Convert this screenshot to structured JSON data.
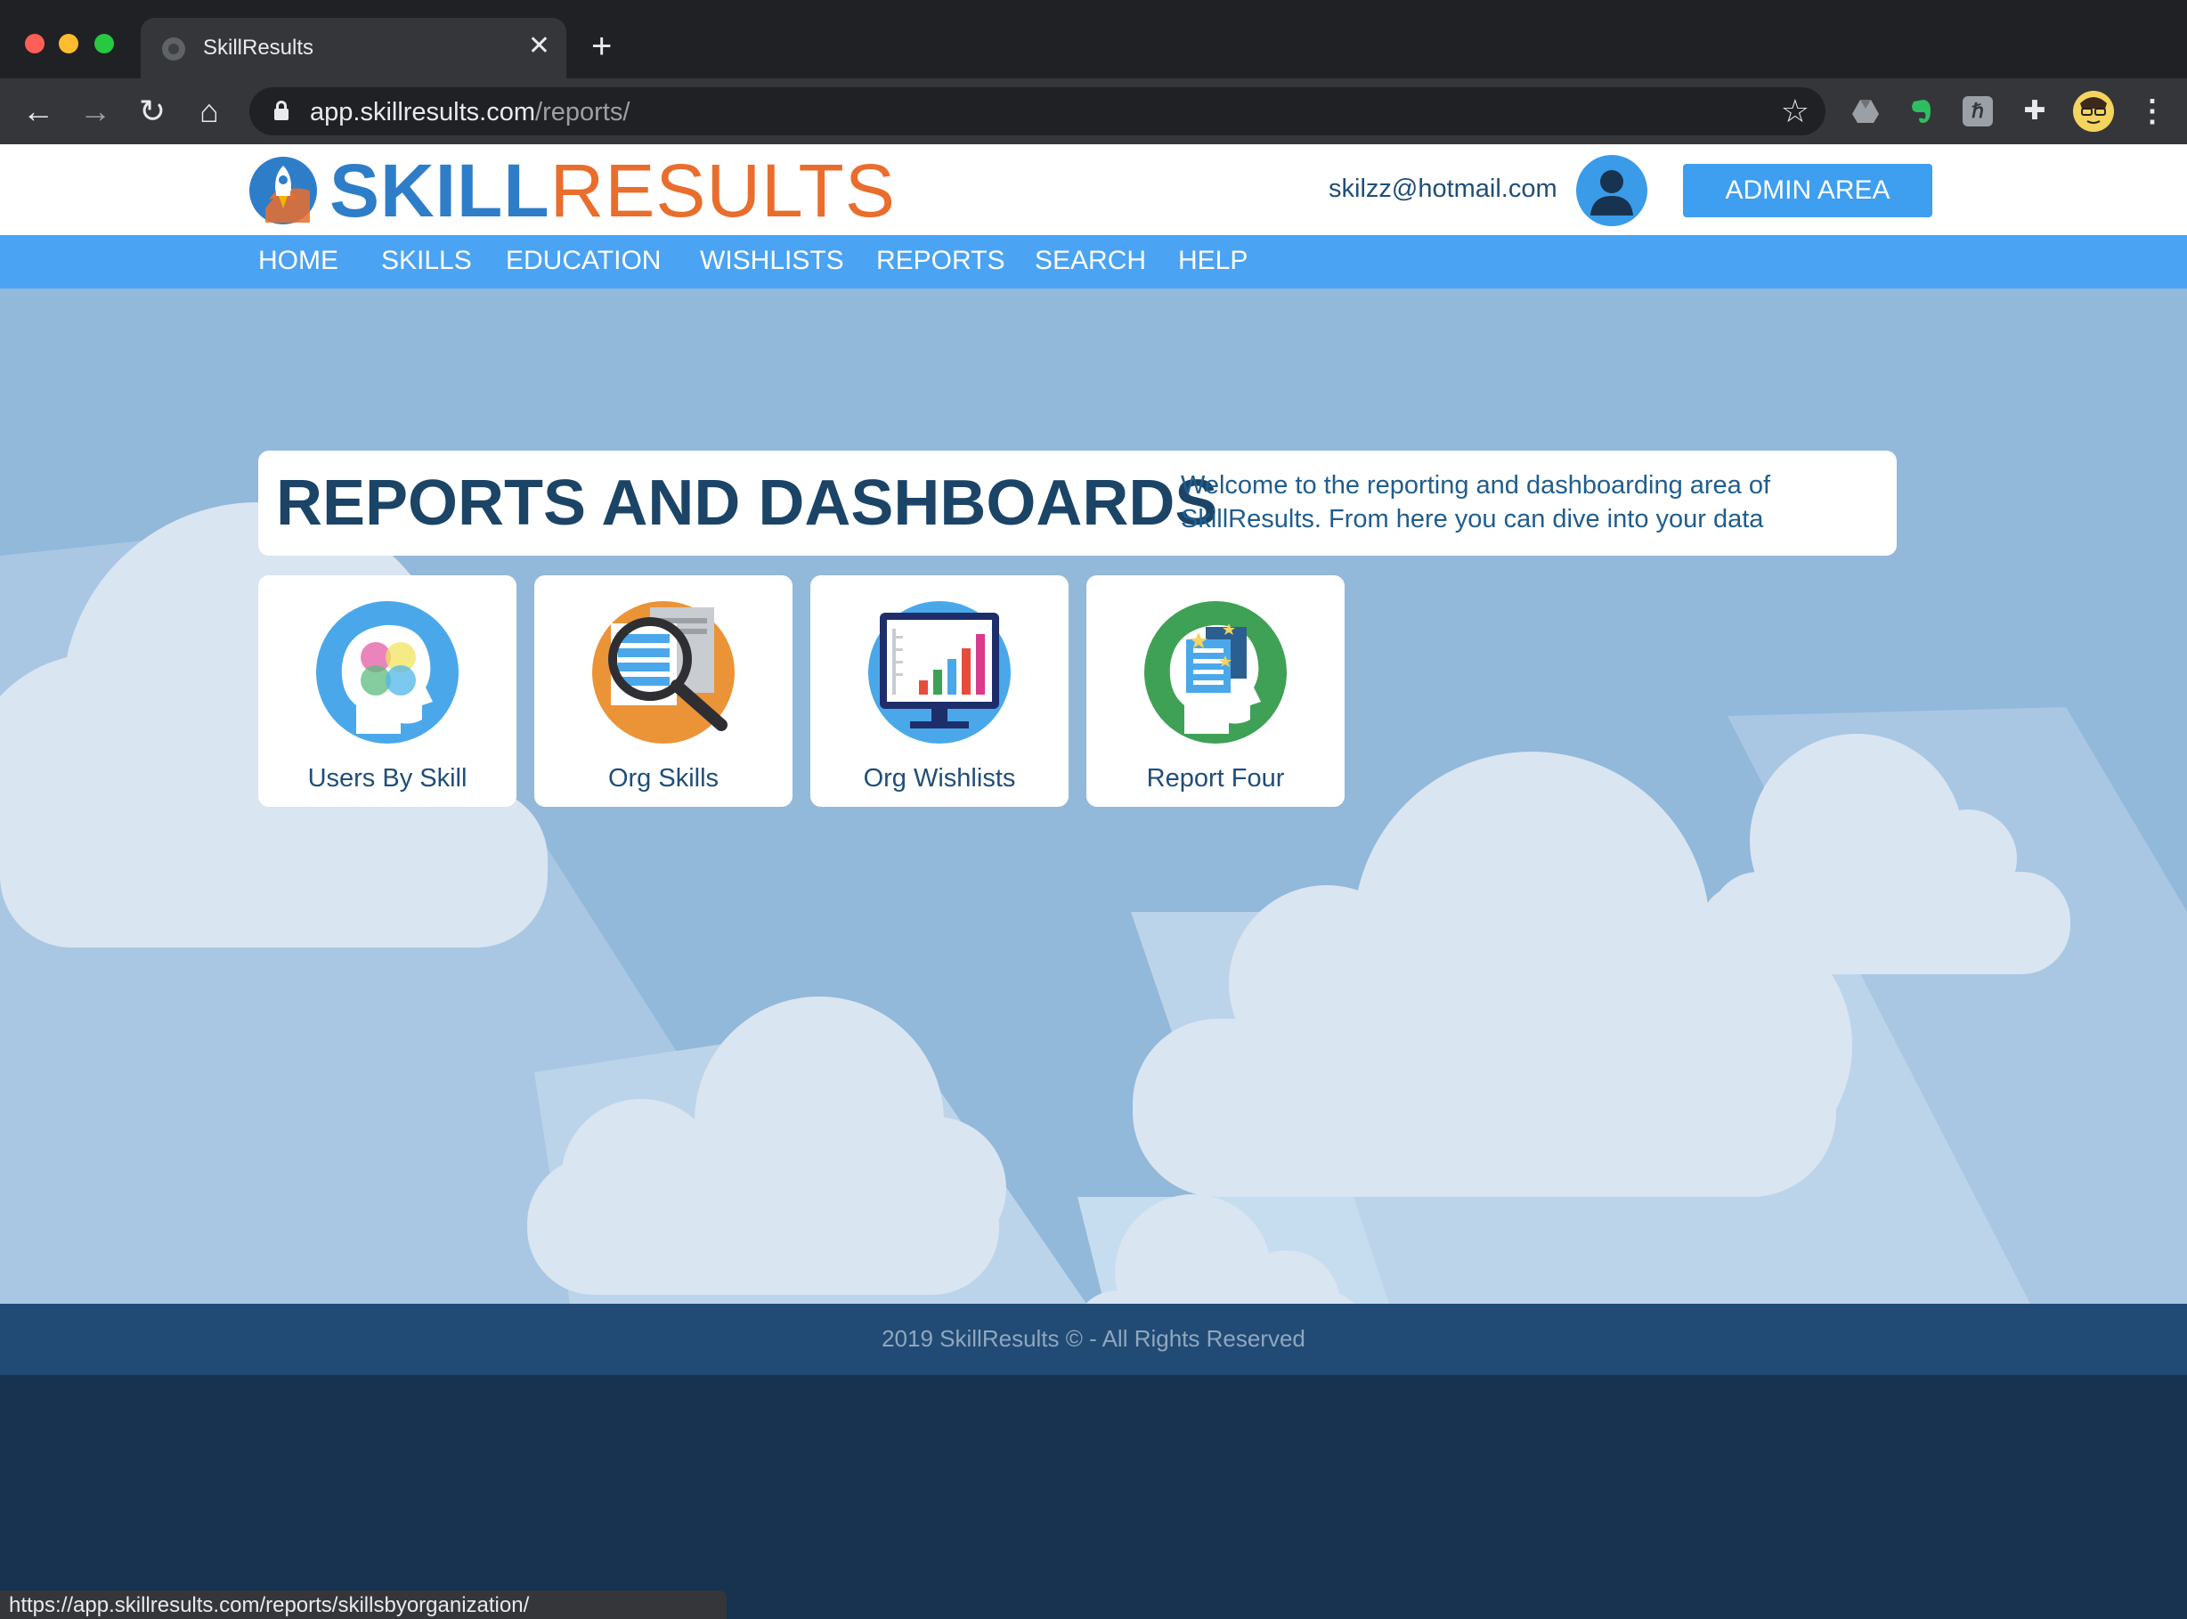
{
  "browser": {
    "tab_title": "SkillResults",
    "url_host": "app.skillresults.com",
    "url_path": "/reports/",
    "status_url": "https://app.skillresults.com/reports/skillsbyorganization/"
  },
  "header": {
    "logo_skill": "SKILL",
    "logo_results": "RESULTS",
    "user_email": "skilzz@hotmail.com",
    "admin_label": "ADMIN AREA"
  },
  "nav": {
    "items": [
      "HOME",
      "SKILLS",
      "EDUCATION",
      "WISHLISTS",
      "REPORTS",
      "SEARCH",
      "HELP"
    ]
  },
  "main": {
    "title": "REPORTS AND DASHBOARDS",
    "intro": "Welcome to the reporting and dashboarding area of SkillResults. From here you can dive into your data",
    "tiles": [
      {
        "label": "Users By Skill",
        "icon": "head-venn-icon",
        "color": "#4aa8ea"
      },
      {
        "label": "Org Skills",
        "icon": "magnifier-document-icon",
        "color": "#ea9437"
      },
      {
        "label": "Org Wishlists",
        "icon": "monitor-bar-chart-icon",
        "color": "#4aa8ea"
      },
      {
        "label": "Report Four",
        "icon": "head-document-icon",
        "color": "#3fa155"
      }
    ]
  },
  "footer": {
    "text": "2019 SkillResults © - All Rights Reserved"
  },
  "colors": {
    "brand_blue": "#2e7dc9",
    "brand_orange": "#e96d2c",
    "nav_blue": "#4aa3f3",
    "sky": "#92b8da",
    "footer": "#214b74"
  }
}
